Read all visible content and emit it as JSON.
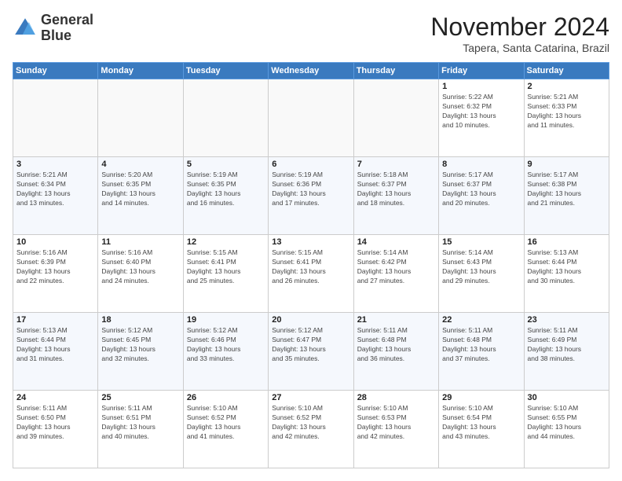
{
  "header": {
    "logo_line1": "General",
    "logo_line2": "Blue",
    "month_title": "November 2024",
    "location": "Tapera, Santa Catarina, Brazil"
  },
  "weekdays": [
    "Sunday",
    "Monday",
    "Tuesday",
    "Wednesday",
    "Thursday",
    "Friday",
    "Saturday"
  ],
  "weeks": [
    [
      {
        "day": "",
        "info": ""
      },
      {
        "day": "",
        "info": ""
      },
      {
        "day": "",
        "info": ""
      },
      {
        "day": "",
        "info": ""
      },
      {
        "day": "",
        "info": ""
      },
      {
        "day": "1",
        "info": "Sunrise: 5:22 AM\nSunset: 6:32 PM\nDaylight: 13 hours\nand 10 minutes."
      },
      {
        "day": "2",
        "info": "Sunrise: 5:21 AM\nSunset: 6:33 PM\nDaylight: 13 hours\nand 11 minutes."
      }
    ],
    [
      {
        "day": "3",
        "info": "Sunrise: 5:21 AM\nSunset: 6:34 PM\nDaylight: 13 hours\nand 13 minutes."
      },
      {
        "day": "4",
        "info": "Sunrise: 5:20 AM\nSunset: 6:35 PM\nDaylight: 13 hours\nand 14 minutes."
      },
      {
        "day": "5",
        "info": "Sunrise: 5:19 AM\nSunset: 6:35 PM\nDaylight: 13 hours\nand 16 minutes."
      },
      {
        "day": "6",
        "info": "Sunrise: 5:19 AM\nSunset: 6:36 PM\nDaylight: 13 hours\nand 17 minutes."
      },
      {
        "day": "7",
        "info": "Sunrise: 5:18 AM\nSunset: 6:37 PM\nDaylight: 13 hours\nand 18 minutes."
      },
      {
        "day": "8",
        "info": "Sunrise: 5:17 AM\nSunset: 6:37 PM\nDaylight: 13 hours\nand 20 minutes."
      },
      {
        "day": "9",
        "info": "Sunrise: 5:17 AM\nSunset: 6:38 PM\nDaylight: 13 hours\nand 21 minutes."
      }
    ],
    [
      {
        "day": "10",
        "info": "Sunrise: 5:16 AM\nSunset: 6:39 PM\nDaylight: 13 hours\nand 22 minutes."
      },
      {
        "day": "11",
        "info": "Sunrise: 5:16 AM\nSunset: 6:40 PM\nDaylight: 13 hours\nand 24 minutes."
      },
      {
        "day": "12",
        "info": "Sunrise: 5:15 AM\nSunset: 6:41 PM\nDaylight: 13 hours\nand 25 minutes."
      },
      {
        "day": "13",
        "info": "Sunrise: 5:15 AM\nSunset: 6:41 PM\nDaylight: 13 hours\nand 26 minutes."
      },
      {
        "day": "14",
        "info": "Sunrise: 5:14 AM\nSunset: 6:42 PM\nDaylight: 13 hours\nand 27 minutes."
      },
      {
        "day": "15",
        "info": "Sunrise: 5:14 AM\nSunset: 6:43 PM\nDaylight: 13 hours\nand 29 minutes."
      },
      {
        "day": "16",
        "info": "Sunrise: 5:13 AM\nSunset: 6:44 PM\nDaylight: 13 hours\nand 30 minutes."
      }
    ],
    [
      {
        "day": "17",
        "info": "Sunrise: 5:13 AM\nSunset: 6:44 PM\nDaylight: 13 hours\nand 31 minutes."
      },
      {
        "day": "18",
        "info": "Sunrise: 5:12 AM\nSunset: 6:45 PM\nDaylight: 13 hours\nand 32 minutes."
      },
      {
        "day": "19",
        "info": "Sunrise: 5:12 AM\nSunset: 6:46 PM\nDaylight: 13 hours\nand 33 minutes."
      },
      {
        "day": "20",
        "info": "Sunrise: 5:12 AM\nSunset: 6:47 PM\nDaylight: 13 hours\nand 35 minutes."
      },
      {
        "day": "21",
        "info": "Sunrise: 5:11 AM\nSunset: 6:48 PM\nDaylight: 13 hours\nand 36 minutes."
      },
      {
        "day": "22",
        "info": "Sunrise: 5:11 AM\nSunset: 6:48 PM\nDaylight: 13 hours\nand 37 minutes."
      },
      {
        "day": "23",
        "info": "Sunrise: 5:11 AM\nSunset: 6:49 PM\nDaylight: 13 hours\nand 38 minutes."
      }
    ],
    [
      {
        "day": "24",
        "info": "Sunrise: 5:11 AM\nSunset: 6:50 PM\nDaylight: 13 hours\nand 39 minutes."
      },
      {
        "day": "25",
        "info": "Sunrise: 5:11 AM\nSunset: 6:51 PM\nDaylight: 13 hours\nand 40 minutes."
      },
      {
        "day": "26",
        "info": "Sunrise: 5:10 AM\nSunset: 6:52 PM\nDaylight: 13 hours\nand 41 minutes."
      },
      {
        "day": "27",
        "info": "Sunrise: 5:10 AM\nSunset: 6:52 PM\nDaylight: 13 hours\nand 42 minutes."
      },
      {
        "day": "28",
        "info": "Sunrise: 5:10 AM\nSunset: 6:53 PM\nDaylight: 13 hours\nand 42 minutes."
      },
      {
        "day": "29",
        "info": "Sunrise: 5:10 AM\nSunset: 6:54 PM\nDaylight: 13 hours\nand 43 minutes."
      },
      {
        "day": "30",
        "info": "Sunrise: 5:10 AM\nSunset: 6:55 PM\nDaylight: 13 hours\nand 44 minutes."
      }
    ]
  ]
}
